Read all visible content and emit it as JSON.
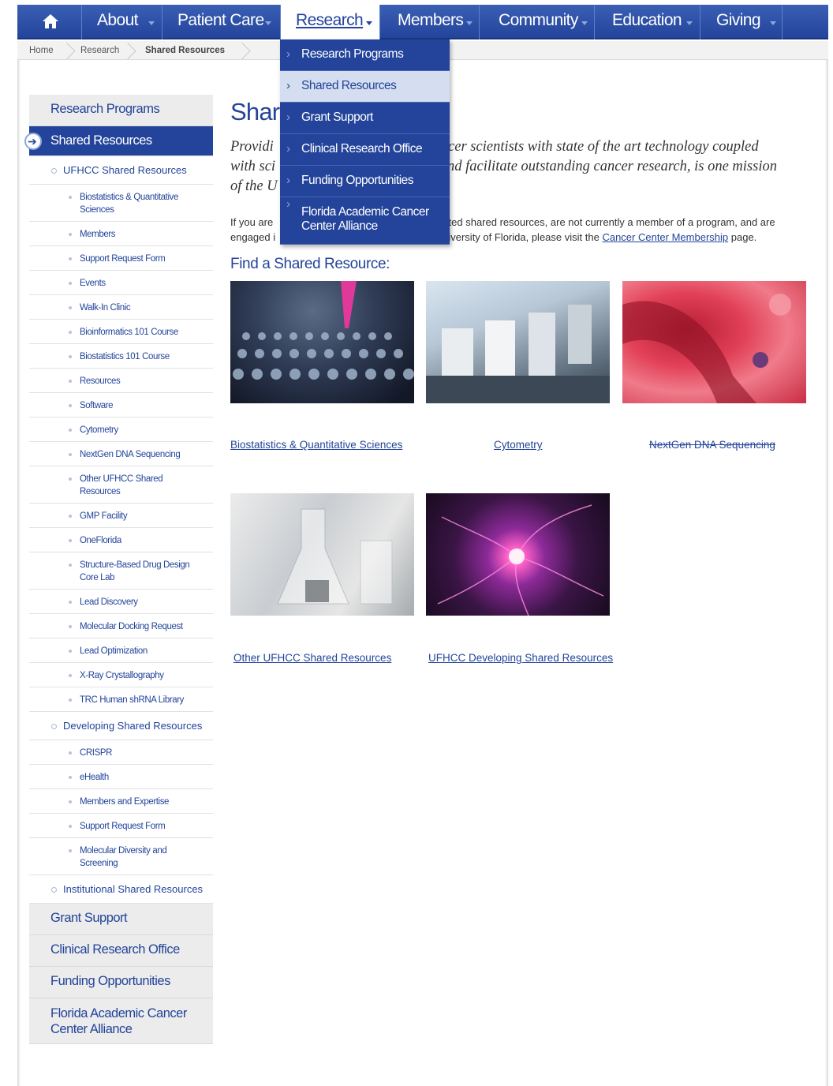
{
  "nav": {
    "home_icon": "home-icon",
    "items": [
      {
        "label": "About"
      },
      {
        "label": "Patient Care"
      },
      {
        "label": "Research"
      },
      {
        "label": "Members"
      },
      {
        "label": "Community"
      },
      {
        "label": "Education"
      },
      {
        "label": "Giving"
      }
    ],
    "active": "Research"
  },
  "breadcrumb": [
    "Home",
    "Research",
    "Shared Resources"
  ],
  "dropdown": [
    "Research Programs",
    "Shared Resources",
    "Grant Support",
    "Clinical Research Office",
    "Funding Opportunities",
    "Florida Academic Cancer Center Alliance"
  ],
  "sidebar": {
    "top1": "Research Programs",
    "top2": "Shared Resources",
    "l2a": "UFHCC Shared Resources",
    "group_a": [
      "Biostatistics & Quantitative Sciences",
      "Members",
      "Support Request Form",
      "Events",
      "Walk-In Clinic",
      "Bioinformatics 101 Course",
      "Biostatistics 101 Course",
      "Resources",
      "Software",
      "Cytometry",
      "NextGen DNA Sequencing",
      "Other UFHCC Shared Resources",
      "GMP Facility",
      "OneFlorida",
      "Structure-Based Drug Design Core Lab",
      "Lead Discovery",
      "Molecular Docking Request",
      "Lead Optimization",
      "X-Ray Crystallography",
      "TRC Human shRNA Library"
    ],
    "l2b": "Developing Shared Resources",
    "group_b": [
      "CRISPR",
      "eHealth",
      "Members and Expertise",
      "Support Request Form",
      "Molecular Diversity and Screening"
    ],
    "l2c": "Institutional Shared Resources",
    "bottom": [
      "Grant Support",
      "Clinical Research Office",
      "Funding Opportunities",
      "Florida Academic Cancer Center Alliance"
    ]
  },
  "main": {
    "title": "Shar",
    "intro_a": "Providi",
    "intro_b": "ncer scientists with state of the art technology coupled",
    "intro_c": "with sci",
    "intro_d": "nd facilitate outstanding cancer research, is one mission",
    "intro_e": "of the U",
    "para_a": "If you are",
    "para_b": "rted shared resources, are not currently a member of a program, and are",
    "para_c": "engaged i",
    "para_d": "niversity of Florida, please visit the",
    "para_link": "Cancer Center Membership",
    "para_e": "page.",
    "find_heading": "Find a Shared Resource:",
    "captions": [
      "Biostatistics & Quantitative Sciences",
      "Cytometry",
      "NextGen DNA Sequencing",
      "Other UFHCC Shared Resources",
      "UFHCC Developing Shared Resources"
    ]
  }
}
